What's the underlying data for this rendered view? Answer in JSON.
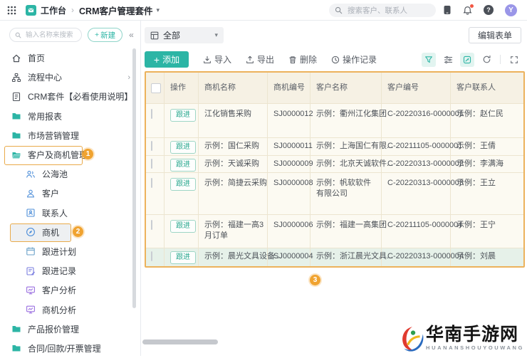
{
  "topbar": {
    "workspace": "工作台",
    "suite": "CRM客户管理套件",
    "search_placeholder": "搜索客户、联系人",
    "avatar": "Y"
  },
  "glyphs": {
    "breadcrumb_sep": "›",
    "caret_down": "▾",
    "collapse": "«",
    "chevron_right": "›",
    "plus": "+"
  },
  "sidebar": {
    "search_placeholder": "输入名称来搜索",
    "new_button": "新建",
    "items": [
      {
        "label": "首页"
      },
      {
        "label": "流程中心"
      },
      {
        "label": "CRM套件【必看使用说明】"
      },
      {
        "label": "常用报表"
      },
      {
        "label": "市场营销管理"
      },
      {
        "label": "客户及商机管理"
      },
      {
        "label": "公海池"
      },
      {
        "label": "客户"
      },
      {
        "label": "联系人"
      },
      {
        "label": "商机"
      },
      {
        "label": "跟进计划"
      },
      {
        "label": "跟进记录"
      },
      {
        "label": "客户分析"
      },
      {
        "label": "商机分析"
      },
      {
        "label": "产品报价管理"
      },
      {
        "label": "合同/回款/开票管理"
      }
    ]
  },
  "viewbar": {
    "current_view": "全部",
    "edit_form_button": "编辑表单"
  },
  "toolbar": {
    "add": "添加",
    "import": "导入",
    "export": "导出",
    "delete": "删除",
    "history": "操作记录"
  },
  "table": {
    "columns": [
      "操作",
      "商机名称",
      "商机编号",
      "客户名称",
      "客户编号",
      "客户联系人"
    ],
    "follow_up_button": "跟进",
    "rows": [
      {
        "name": "江化销售采购",
        "no": "SJ0000012",
        "customer": "示例：衢州江化集团",
        "customer_no": "C-20220316-0000001",
        "contact": "示例：赵仁民"
      },
      {
        "name": "示例：国仁采购",
        "no": "SJ0000011",
        "customer": "示例：上海国仁有限...",
        "customer_no": "C-20211105-0000001",
        "contact": "示例：王倩"
      },
      {
        "name": "示例：天诚采购",
        "no": "SJ0000009",
        "customer": "示例：北京天诚软件...",
        "customer_no": "C-20220313-0000002",
        "contact": "示例：李满海"
      },
      {
        "name": "示例：简捷云采购",
        "no": "SJ0000008",
        "customer": "示例：帆软软件有限公司",
        "customer_no": "C-20220313-0000003",
        "contact": "示例：王立"
      },
      {
        "name": "示例：福建一高3月订单",
        "no": "SJ0000006",
        "customer": "示例：福建一高集团",
        "customer_no": "C-20211105-0000004",
        "contact": "示例：王宁"
      },
      {
        "name": "示例：晨光文具设备...",
        "no": "SJ0000004",
        "customer": "示例：浙江晨光文具...",
        "customer_no": "C-20220313-0000004",
        "contact": "示例：刘晨"
      }
    ]
  },
  "annotations": {
    "step1": "1",
    "step2": "2",
    "step3": "3"
  },
  "watermark": {
    "title": "华南手游网",
    "subtitle": "HUANANSHOUYOUWANG"
  },
  "colors": {
    "accent_teal": "#2cb5a5",
    "annotation_orange": "#f0a330",
    "icon_blue": "#4f8fd9",
    "icon_purple": "#9a6fe0",
    "selected_row_green": "#e6f1e9",
    "notification_red": "#f25643",
    "avatar_purple": "#9a96e8",
    "table_highlight_border": "#ecb25c"
  }
}
